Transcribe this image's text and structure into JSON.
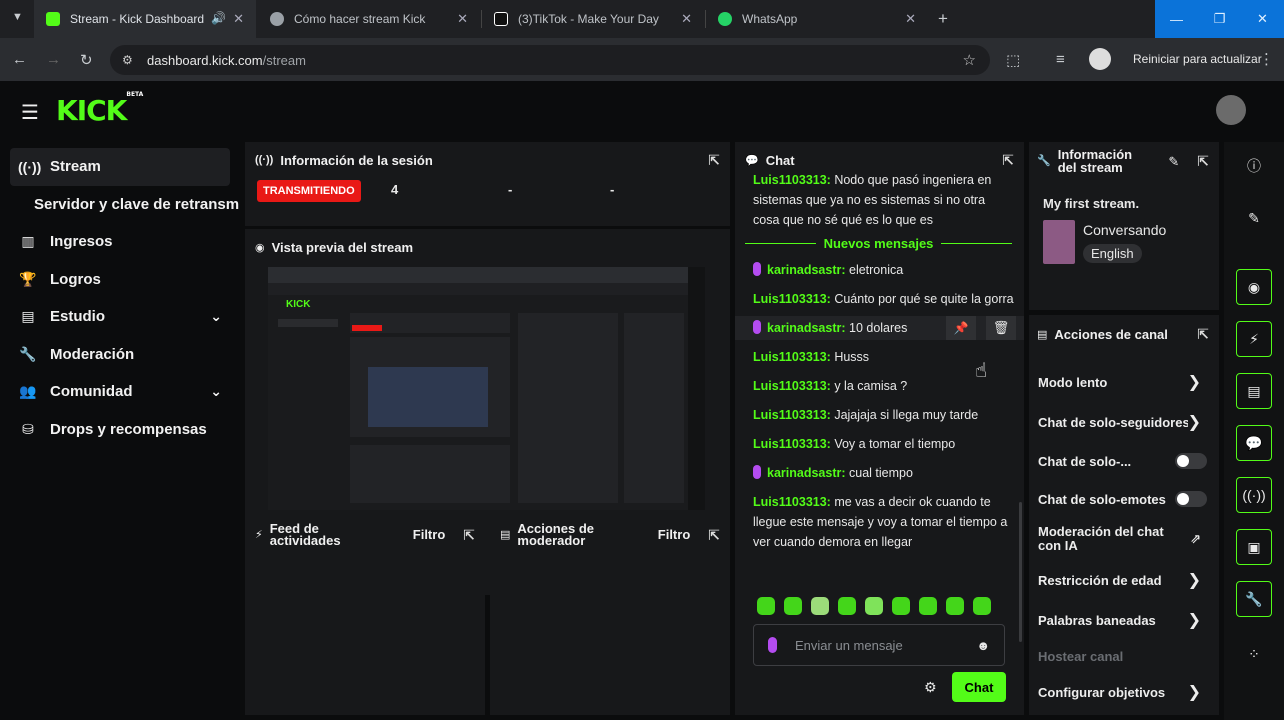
{
  "browser": {
    "tabs": [
      {
        "title": "Stream - Kick Dashboard",
        "favicon_color": "#53fc18",
        "active": true
      },
      {
        "title": "Cómo hacer stream Kick",
        "favicon_color": "#9aa0a6"
      },
      {
        "title": "(3)TikTok - Make Your Day",
        "favicon_color": "#ffffff"
      },
      {
        "title": "WhatsApp",
        "favicon_color": "#25d366"
      }
    ],
    "url_host": "dashboard.kick.com",
    "url_path": "/stream",
    "update_button": "Reiniciar para actualizar"
  },
  "app": {
    "logo": "KICK",
    "logo_sup": "BETA"
  },
  "sidebar": {
    "items": [
      {
        "label": "Stream",
        "icon": "broadcast-icon",
        "active": true
      },
      {
        "label": "Servidor y clave de retransm",
        "sub": true
      },
      {
        "label": "Ingresos",
        "icon": "bars-icon"
      },
      {
        "label": "Logros",
        "icon": "trophy-icon"
      },
      {
        "label": "Estudio",
        "icon": "studio-icon",
        "expandable": true
      },
      {
        "label": "Moderación",
        "icon": "wrench-icon"
      },
      {
        "label": "Comunidad",
        "icon": "people-icon",
        "expandable": true
      },
      {
        "label": "Drops y recompensas",
        "icon": "drops-icon"
      }
    ]
  },
  "session": {
    "title": "Información de la sesión",
    "status": "TRANSMITIENDO",
    "viewers": "4",
    "stat2": "-",
    "stat3": "-"
  },
  "preview": {
    "title": "Vista previa del stream"
  },
  "feed": {
    "title_line1": "Feed de",
    "title_line2": "actividades",
    "filter": "Filtro"
  },
  "modactions": {
    "title_line1": "Acciones de",
    "title_line2": "moderador",
    "filter": "Filtro"
  },
  "chat": {
    "title": "Chat",
    "top_msg": {
      "user": "Luis1103313:",
      "text": " Nodo que pasó ingeniera en sistemas que ya no es sistemas si no otra cosa que no sé qué es lo que es"
    },
    "new_divider": "Nuevos mensajes",
    "messages": [
      {
        "user": "karinadsastr:",
        "text": " eletronica",
        "mic": true
      },
      {
        "user": "Luis1103313:",
        "text": " Cuánto por qué se quite la gorra"
      },
      {
        "user": "karinadsastr:",
        "text": " 10 dolares",
        "mic": true
      },
      {
        "user": "Luis1103313:",
        "text": " Husss"
      },
      {
        "user": "Luis1103313:",
        "text": " y la camisa ?"
      },
      {
        "user": "Luis1103313:",
        "text": " Jajajaja si llega muy tarde"
      },
      {
        "user": "Luis1103313:",
        "text": " Voy a tomar el tiempo"
      },
      {
        "user": "karinadsastr:",
        "text": " cual tiempo",
        "mic": true
      },
      {
        "user": "Luis1103313:",
        "text": " me vas a decir ok cuando te llegue este mensaje y voy a tomar el tiempo a ver cuando demora en llegar"
      }
    ],
    "input_placeholder": "Enviar un mensaje",
    "send_label": "Chat"
  },
  "stream_info": {
    "title_line1": "Información",
    "title_line2": "del stream",
    "stream_title": "My first stream.",
    "category": "Conversando",
    "language": "English"
  },
  "channel_actions": {
    "title": "Acciones de canal",
    "items": [
      {
        "label": "Modo lento",
        "kind": "chevron"
      },
      {
        "label": "Chat de solo-seguidores",
        "kind": "chevron"
      },
      {
        "label": "Chat de solo-...",
        "kind": "toggle"
      },
      {
        "label": "Chat de solo-emotes",
        "kind": "toggle"
      },
      {
        "label": "Moderación del chat con IA",
        "kind": "external"
      },
      {
        "label": "Restricción de edad",
        "kind": "chevron"
      },
      {
        "label": "Palabras baneadas",
        "kind": "chevron"
      },
      {
        "label": "Hostear canal",
        "kind": "disabled"
      },
      {
        "label": "Configurar objetivos",
        "kind": "chevron"
      }
    ]
  },
  "colors": {
    "accent": "#53fc18",
    "live": "#e91916",
    "mic": "#b44cf0"
  }
}
